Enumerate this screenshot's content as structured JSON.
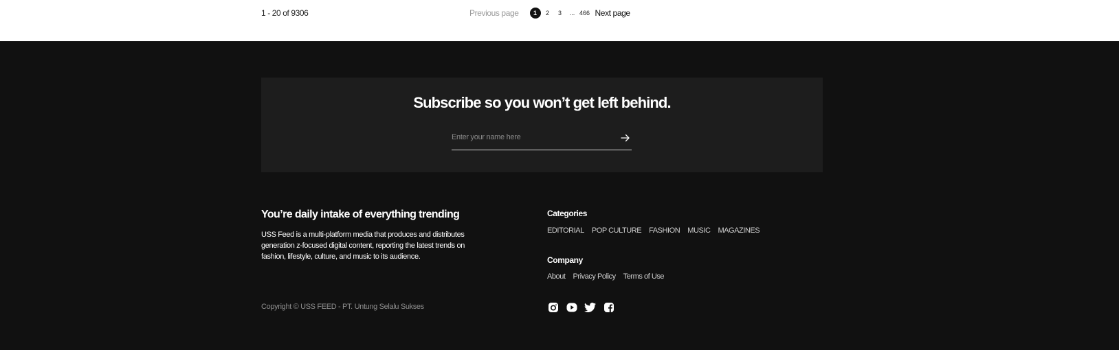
{
  "pagination": {
    "result_count": "1 - 20 of 9306",
    "previous_label": "Previous page",
    "pages": [
      "1",
      "2",
      "3"
    ],
    "ellipsis": "...",
    "last_page": "466",
    "next_label": "Next page",
    "current_page": "1"
  },
  "subscribe": {
    "title": "Subscribe so you won’t get left behind.",
    "placeholder": "Enter your name here",
    "submit_icon": "arrow-right-icon"
  },
  "about": {
    "title": "You’re daily intake of everything trending",
    "description": "USS Feed is a multi-platform media that produces and distributes generation z-focused digital content, reporting the latest trends on fashion, lifestyle, culture, and music to its audience."
  },
  "categories": {
    "heading": "Categories",
    "items": [
      "EDITORIAL",
      "POP CULTURE",
      "FASHION",
      "MUSIC",
      "MAGAZINES"
    ]
  },
  "company": {
    "heading": "Company",
    "items": [
      "About",
      "Privacy Policy",
      "Terms of Use"
    ]
  },
  "copyright": "Copyright © USS FEED - PT. Untung Selalu Sukses",
  "social": [
    "instagram-icon",
    "youtube-icon",
    "twitter-icon",
    "facebook-icon"
  ],
  "colors": {
    "footer_background": "#111111",
    "subscribe_background": "#1d1d1d",
    "top_background": "#ffffff"
  }
}
